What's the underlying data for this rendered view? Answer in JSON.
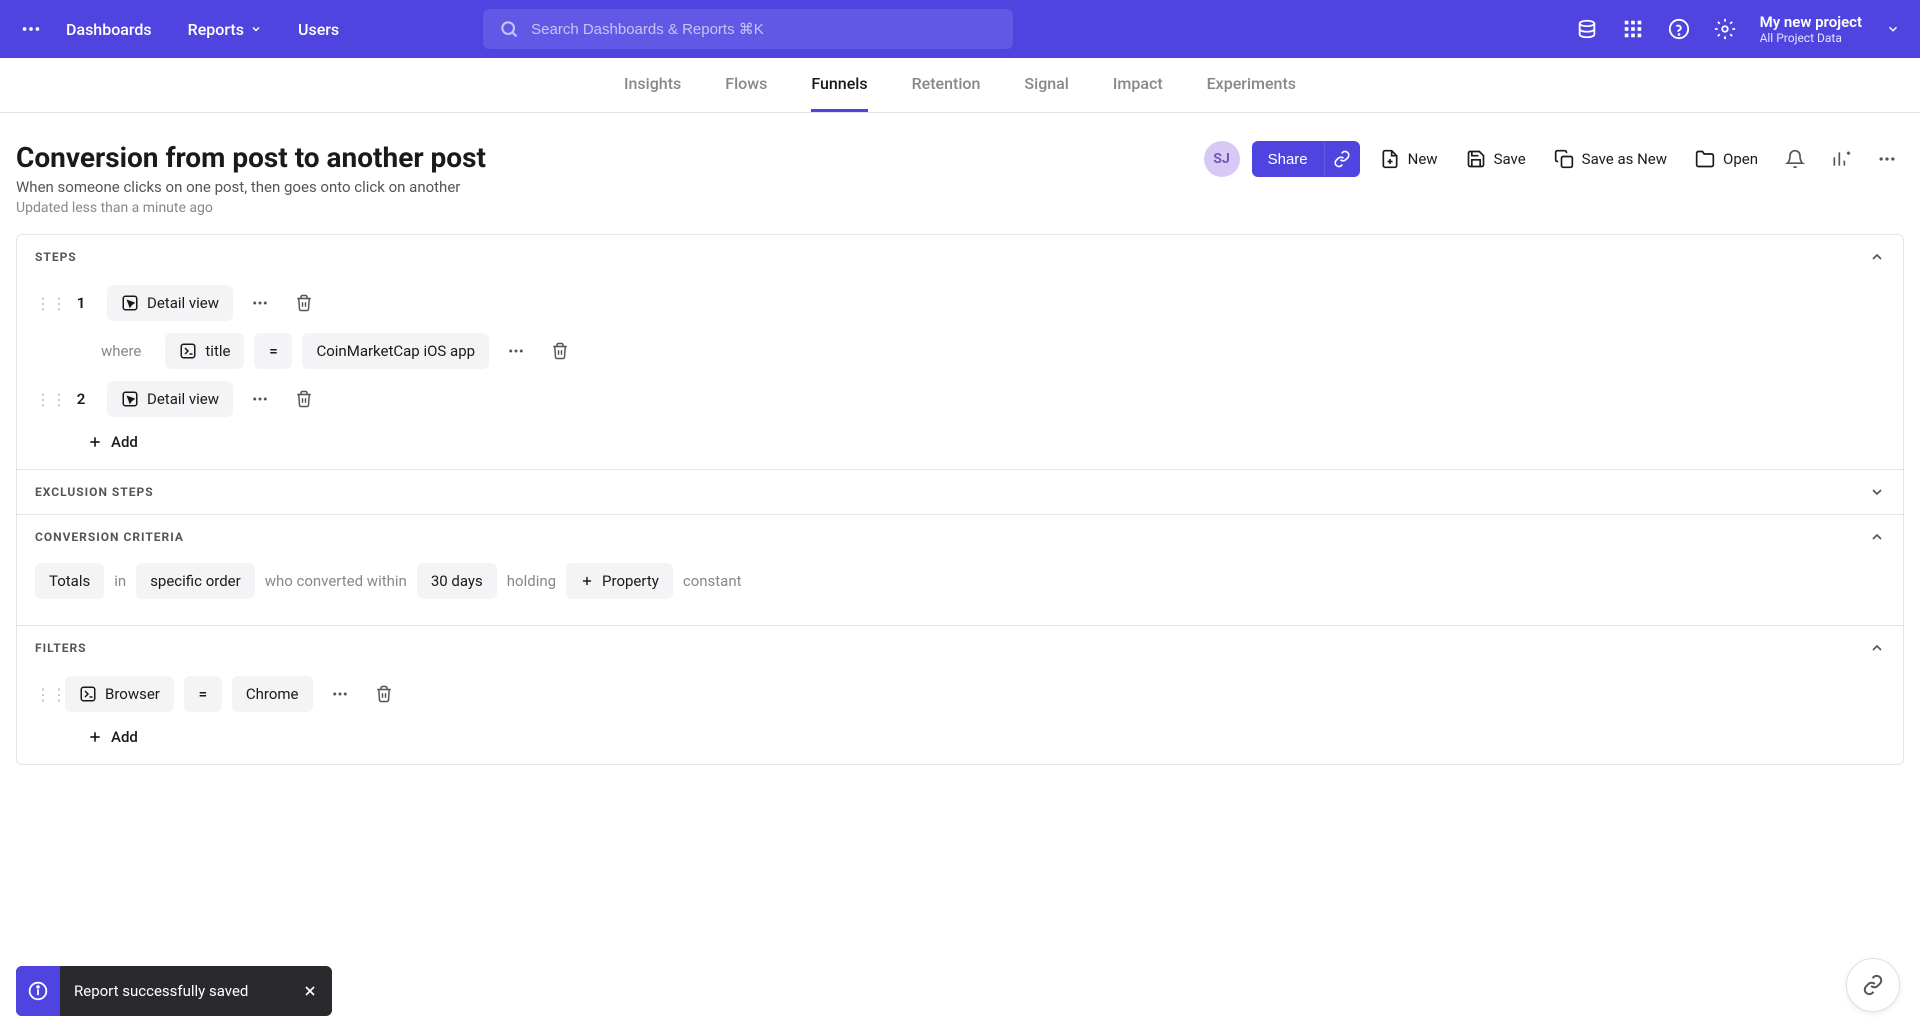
{
  "header": {
    "nav": {
      "dashboards": "Dashboards",
      "reports": "Reports",
      "users": "Users"
    },
    "search_placeholder": "Search Dashboards & Reports ⌘K",
    "project_name": "My new project",
    "project_sub": "All Project Data"
  },
  "subnav": {
    "insights": "Insights",
    "flows": "Flows",
    "funnels": "Funnels",
    "retention": "Retention",
    "signal": "Signal",
    "impact": "Impact",
    "experiments": "Experiments"
  },
  "report": {
    "title": "Conversion from post to another post",
    "description": "When someone clicks on one post, then goes onto click on another",
    "updated": "Updated less than a minute ago",
    "owner_initials": "SJ",
    "actions": {
      "share": "Share",
      "new": "New",
      "save": "Save",
      "save_as": "Save as New",
      "open": "Open"
    }
  },
  "sections": {
    "steps": "STEPS",
    "exclusion": "EXCLUSION STEPS",
    "criteria": "CONVERSION CRITERIA",
    "filters": "FILTERS"
  },
  "steps": [
    {
      "num": "1",
      "label": "Detail view",
      "where": {
        "label": "where",
        "property": "title",
        "op": "=",
        "value": "CoinMarketCap iOS app"
      }
    },
    {
      "num": "2",
      "label": "Detail view"
    }
  ],
  "add_label": "Add",
  "criteria": {
    "totals": "Totals",
    "in": "in",
    "order": "specific order",
    "who": "who converted within",
    "window": "30 days",
    "holding": "holding",
    "property": "Property",
    "constant": "constant"
  },
  "filters": [
    {
      "property": "Browser",
      "op": "=",
      "value": "Chrome"
    }
  ],
  "toast": "Report successfully saved"
}
